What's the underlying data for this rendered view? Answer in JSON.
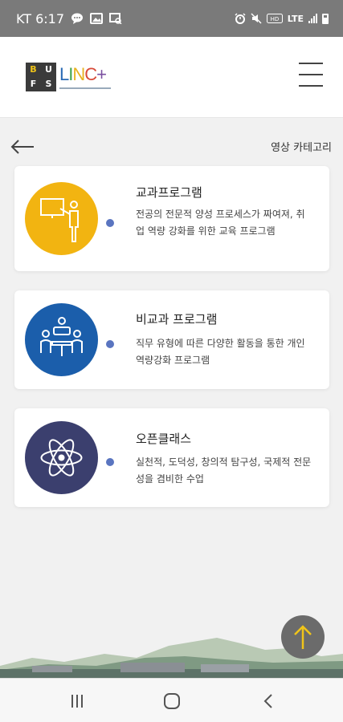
{
  "status_bar": {
    "carrier_time": "KT 6:17",
    "network": "LTE",
    "left_icons": [
      "chat-icon",
      "gallery-icon",
      "screenshot-icon"
    ],
    "right_icons": [
      "alarm-icon",
      "mute-icon",
      "volte-icon",
      "signal-icon",
      "battery-icon"
    ]
  },
  "header": {
    "logo_bufs": [
      "B",
      "U",
      "F",
      "S"
    ],
    "logo_linc": [
      "L",
      "I",
      "N",
      "C",
      "+"
    ]
  },
  "page": {
    "title": "영상 카테고리"
  },
  "categories": [
    {
      "title": "교과프로그램",
      "description": "전공의 전문적 양성 프로세스가 짜여져, 취업 역량 강화를 위한 교육 프로그램",
      "icon": "teacher-board-icon",
      "color": "#f2b411"
    },
    {
      "title": "비교과 프로그램",
      "description": "직무 유형에 따른 다양한 활동을 통한 개인역량강화 프로그램",
      "icon": "group-discussion-icon",
      "color": "#1b5eab"
    },
    {
      "title": "오픈클래스",
      "description": "실천적, 도덕성, 창의적 탐구성, 국제적 전문성을 겸비한 수업",
      "icon": "atom-icon",
      "color": "#3b3f6e"
    }
  ],
  "colors": {
    "dot": "#5a75c0",
    "fab": "#6b6b6b",
    "fab_arrow": "#f0c419"
  }
}
